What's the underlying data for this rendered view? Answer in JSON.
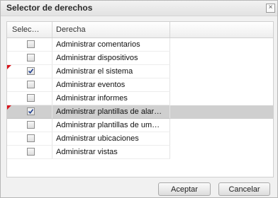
{
  "dialog": {
    "title": "Selector de derechos",
    "close_label": "×"
  },
  "grid": {
    "columns": [
      "Selec…",
      "Derecha"
    ],
    "rows": [
      {
        "label": "Administrar comentarios",
        "checked": false,
        "dirty": false,
        "selected": false
      },
      {
        "label": "Administrar dispositivos",
        "checked": false,
        "dirty": false,
        "selected": false
      },
      {
        "label": "Administrar el sistema",
        "checked": true,
        "dirty": true,
        "selected": false
      },
      {
        "label": "Administrar eventos",
        "checked": false,
        "dirty": false,
        "selected": false
      },
      {
        "label": "Administrar informes",
        "checked": false,
        "dirty": false,
        "selected": false
      },
      {
        "label": "Administrar plantillas de alar…",
        "checked": true,
        "dirty": true,
        "selected": true
      },
      {
        "label": "Administrar plantillas de um…",
        "checked": false,
        "dirty": false,
        "selected": false
      },
      {
        "label": "Administrar ubicaciones",
        "checked": false,
        "dirty": false,
        "selected": false
      },
      {
        "label": "Administrar vistas",
        "checked": false,
        "dirty": false,
        "selected": false
      }
    ]
  },
  "buttons": {
    "accept_label": "Aceptar",
    "cancel_label": "Cancelar"
  },
  "colors": {
    "dirty_marker": "#d8141b",
    "selected_row": "#cfcfcf",
    "checkmark": "#1f3f8f"
  }
}
